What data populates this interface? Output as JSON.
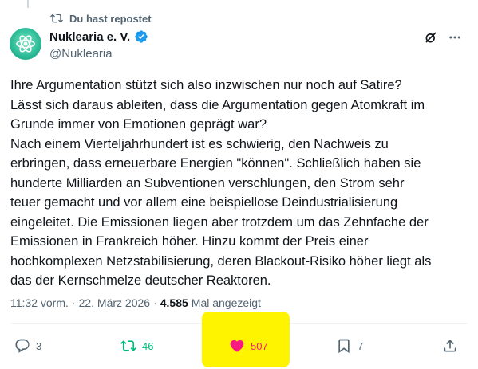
{
  "repost": {
    "label": "Du hast repostet",
    "icon": "repost-icon"
  },
  "author": {
    "name": "Nuklearia e. V.",
    "handle": "@Nuklearia",
    "verified": true,
    "avatar": "atom-logo"
  },
  "post": {
    "text": "Ihre Argumentation stützt sich also inzwischen nur noch auf Satire?\nLässt sich daraus ableiten, dass die Argumentation gegen Atomkraft im\nGrunde immer von Emotionen geprägt war?\nNach einem Vierteljahrhundert ist es schwierig, den Nachweis zu\nerbringen, dass erneuerbare Energien \"können\". Schließlich haben sie\nhunderte Milliarden an Subventionen verschlungen, den Strom sehr\nteuer gemacht und vor allem eine beispiellose Deindustrialisierung\neingeleitet. Die Emissionen liegen aber trotzdem um das Zehnfache der\nEmissionen in Frankreich höher. Hinzu kommt der Preis einer\nhochkomplexen Netzstabilisierung, deren Blackout-Risiko höher liegt als\ndas der Kernschmelze deutscher Reaktoren.",
    "time": "11:32 vorm.",
    "date": "22. März 2026",
    "separator": "·",
    "views": "4.585",
    "views_label": "Mal angezeigt"
  },
  "actions": {
    "replies": "3",
    "reposts": "46",
    "likes": "507",
    "bookmarks": "7"
  },
  "colors": {
    "repost_active": "#00ba7c",
    "like_active": "#f91880",
    "verified": "#1d9bf0",
    "highlight": "#fff400"
  }
}
